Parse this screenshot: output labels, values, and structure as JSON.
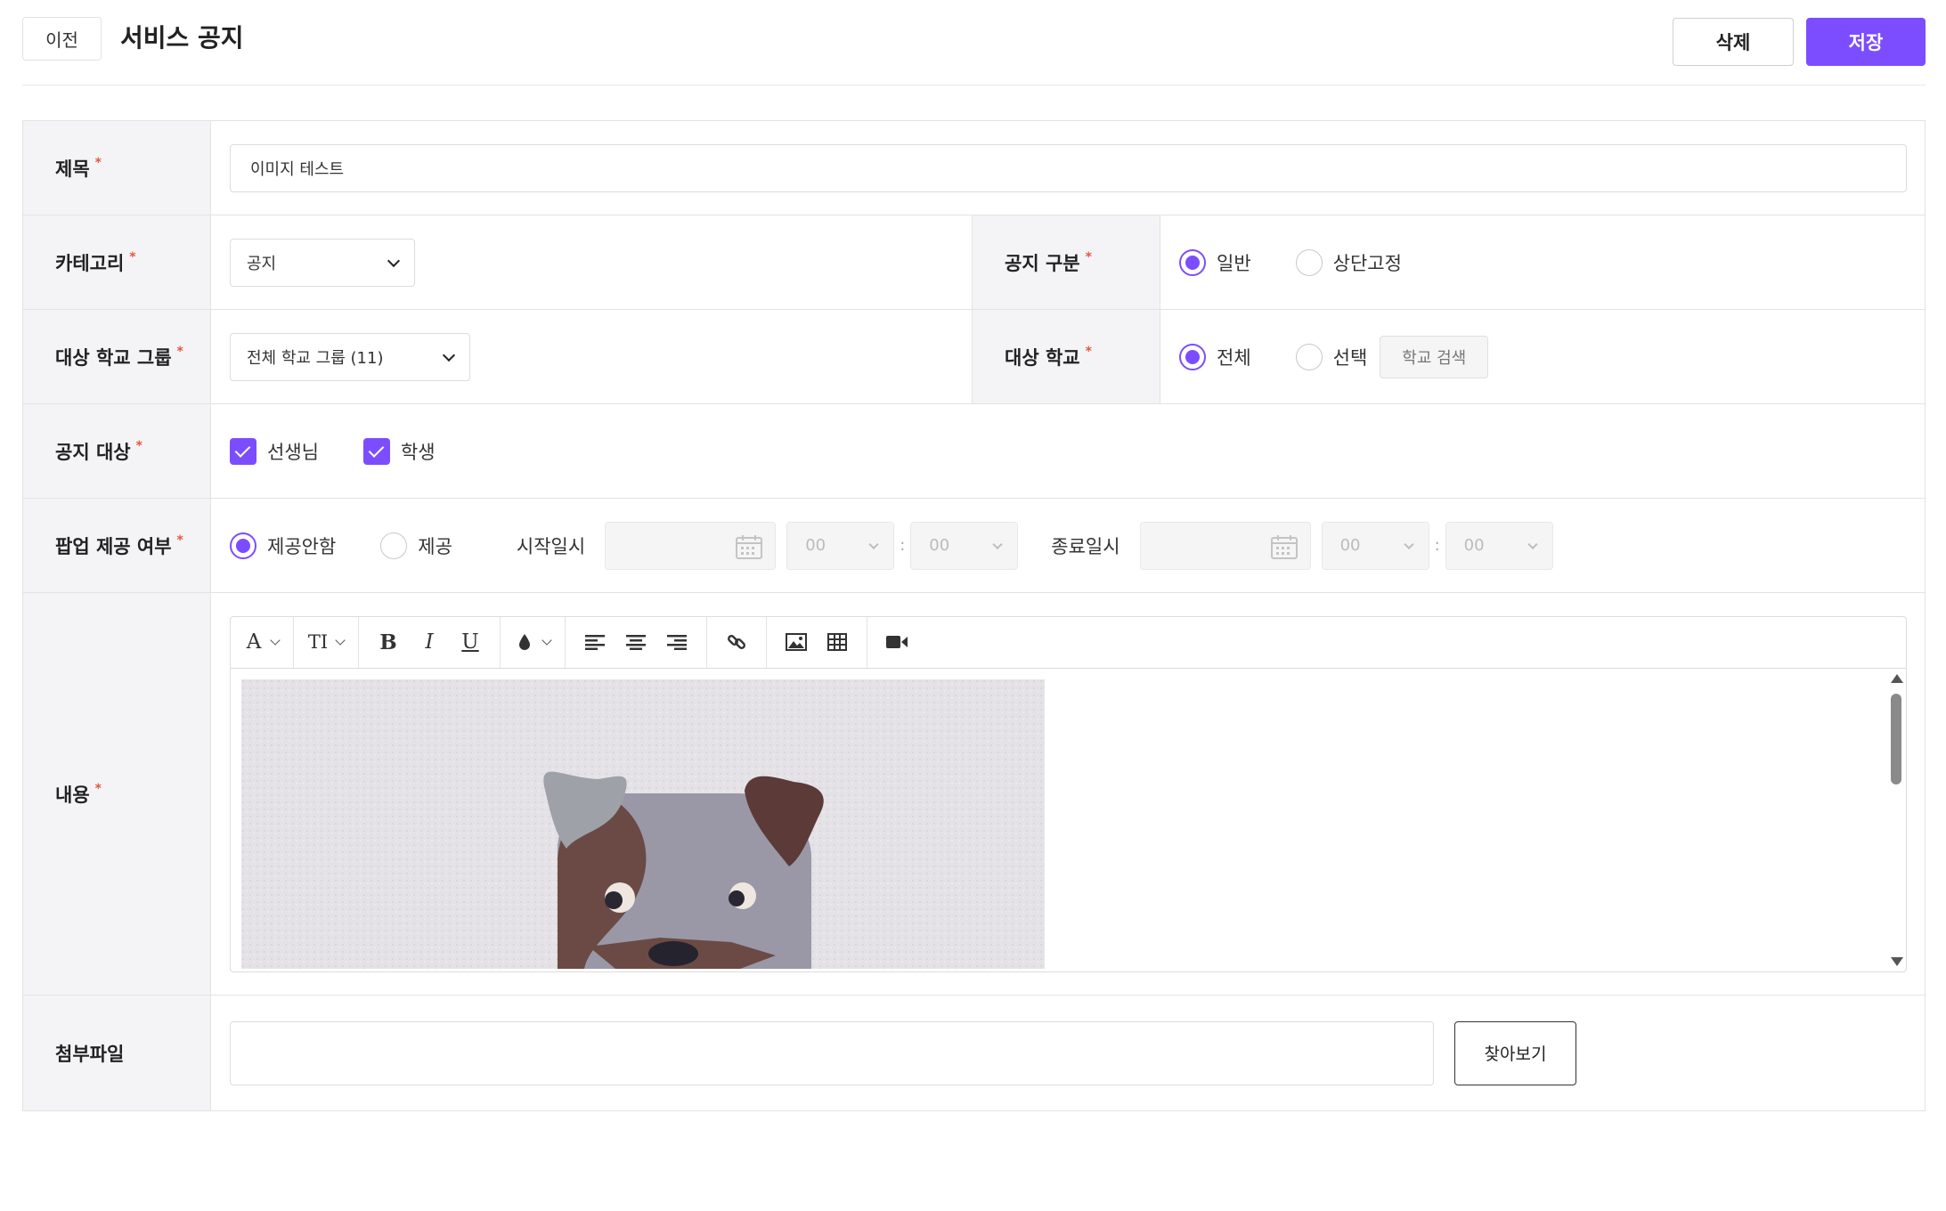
{
  "header": {
    "back_label": "이전",
    "title": "서비스 공지",
    "delete_label": "삭제",
    "save_label": "저장"
  },
  "form": {
    "required_mark": "*",
    "title": {
      "label": "제목",
      "value": "이미지 테스트"
    },
    "category": {
      "label": "카테고리",
      "selected": "공지"
    },
    "notice_type": {
      "label": "공지 구분",
      "options": [
        "일반",
        "상단고정"
      ],
      "selected": "일반"
    },
    "school_group": {
      "label": "대상 학교 그룹",
      "selected": "전체 학교 그룹 (11)"
    },
    "school": {
      "label": "대상 학교",
      "options": [
        "전체",
        "선택"
      ],
      "selected": "전체",
      "search_button": "학교 검색"
    },
    "target": {
      "label": "공지 대상",
      "options": [
        "선생님",
        "학생"
      ],
      "checked": [
        "선생님",
        "학생"
      ]
    },
    "popup": {
      "label": "팝업 제공 여부",
      "options": [
        "제공안함",
        "제공"
      ],
      "selected": "제공안함",
      "start_label": "시작일시",
      "end_label": "종료일시",
      "start_hour": "00",
      "start_minute": "00",
      "end_hour": "00",
      "end_minute": "00",
      "time_separator": ":"
    },
    "content": {
      "label": "내용",
      "toolbar_glyphs": {
        "font": "A",
        "text_size": "TI",
        "bold": "B",
        "italic": "I",
        "underline": "U"
      }
    },
    "attachment": {
      "label": "첨부파일",
      "browse_label": "찾아보기"
    }
  },
  "colors": {
    "accent": "#7c4dff",
    "required": "#e4573e",
    "label_bg": "#f4f4f7"
  }
}
